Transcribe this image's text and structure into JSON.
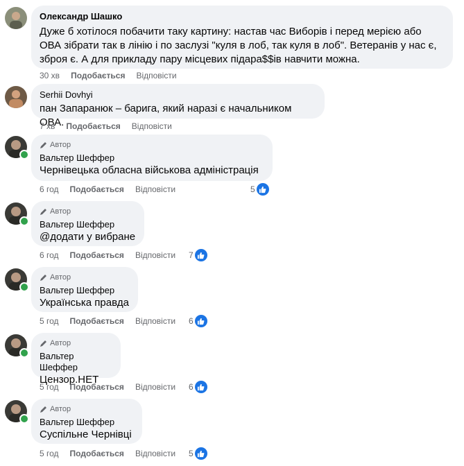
{
  "comments": [
    {
      "author": "Олександр Шашко",
      "is_author": false,
      "text": "Дуже б хотілося побачити таку картину: настав час Виборів і перед мерією або ОВА зібрати так в лінію і по заслузі \"куля в лоб, так куля в лоб\". Ветеранів у нас є, зброя є. А для прикладу пару місцевих підара$$ів навчити можна.",
      "time": "30 хв",
      "like_label": "Подобається",
      "reply_label": "Відповісти",
      "reactions": ""
    },
    {
      "author": "Serhii Dovhyi",
      "is_author": false,
      "text": "пан Запаранюк – барига, який наразі є начальником ОВА.",
      "time": "7 хв",
      "like_label": "Подобається",
      "reply_label": "Відповісти",
      "reactions": ""
    },
    {
      "author": "Вальтер Шеффер",
      "is_author": true,
      "author_badge": "Автор",
      "text": "Чернівецька обласна військова адміністрація",
      "time": "6 год",
      "like_label": "Подобається",
      "reply_label": "Відповісти",
      "reactions": "5"
    },
    {
      "author": "Вальтер Шеффер",
      "is_author": true,
      "author_badge": "Автор",
      "text": "@додати у вибране",
      "time": "6 год",
      "like_label": "Подобається",
      "reply_label": "Відповісти",
      "reactions": "7"
    },
    {
      "author": "Вальтер Шеффер",
      "is_author": true,
      "author_badge": "Автор",
      "text": "Українська правда",
      "time": "5 год",
      "like_label": "Подобається",
      "reply_label": "Відповісти",
      "reactions": "6"
    },
    {
      "author": "Вальтер Шеффер",
      "is_author": true,
      "author_badge": "Автор",
      "text": "Цензор.НЕТ",
      "time": "5 год",
      "like_label": "Подобається",
      "reply_label": "Відповісти",
      "reactions": "6"
    },
    {
      "author": "Вальтер Шеффер",
      "is_author": true,
      "author_badge": "Автор",
      "text": "Суспільне Чернівці",
      "time": "5 год",
      "like_label": "Подобається",
      "reply_label": "Відповісти",
      "reactions": "5"
    }
  ],
  "colors": {
    "bubble": "#f0f2f5",
    "meta_text": "#65676b",
    "like_blue": "#1b74e4",
    "online": "#31a24c"
  },
  "icons": {
    "author_badge": "pencil-icon",
    "reaction": "thumbs-up-icon"
  }
}
